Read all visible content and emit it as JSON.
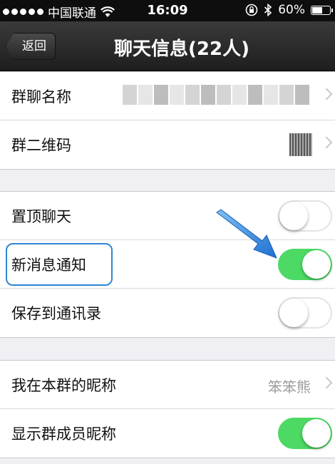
{
  "status_bar": {
    "carrier": "中国联通",
    "time": "16:09",
    "battery": "60%",
    "battery_level": 0.6
  },
  "nav": {
    "back_label": "返回",
    "title": "聊天信息(22人)"
  },
  "section1": {
    "group_name_label": "群聊名称",
    "qr_label": "群二维码"
  },
  "section2": {
    "pin_label": "置顶聊天",
    "pin_on": false,
    "notify_label": "新消息通知",
    "notify_on": true,
    "save_label": "保存到通讯录",
    "save_on": false
  },
  "section3": {
    "nickname_label": "我在本群的昵称",
    "nickname_value": "笨笨熊",
    "show_names_label": "显示群成员昵称",
    "show_names_on": true
  },
  "colors": {
    "toggle_on": "#4cd964",
    "highlight": "#2f86d6"
  },
  "icons": [
    "signal-dots-icon",
    "wifi-icon",
    "rotation-lock-icon",
    "bluetooth-icon",
    "battery-icon",
    "chevron-right-icon",
    "qr-code-icon",
    "arrow-icon"
  ]
}
